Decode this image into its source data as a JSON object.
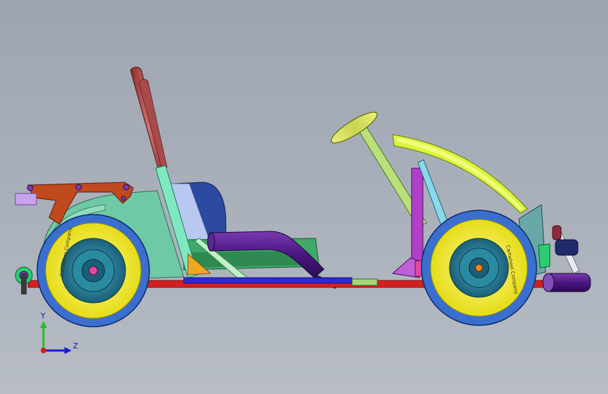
{
  "viewport": {
    "background_top": "#9ea5b1",
    "background_bottom": "#b8bdc5"
  },
  "triad": {
    "y_label": "Y",
    "z_label": "Z",
    "y_color": "#22c022",
    "z_color": "#1a1ad0",
    "x_color": "#d02020"
  },
  "tire_text": {
    "rear": "Cartwheel Company",
    "front": "Cartwheel Company"
  },
  "colors": {
    "tire": "#3a6fd0",
    "rim": "#f3ee2a",
    "hub": "#1e6f8a",
    "seat_back": "#2c4aa0",
    "fender": "#6fc9a6",
    "rear_bracket": "#c0491e",
    "exhaust": "#5a1f8a",
    "frame_red": "#d62020",
    "frame_blue": "#2a2ad6",
    "steering": "#b9e07a",
    "nose": "#d8f53a",
    "upright": "#b040c8",
    "bumper": "#5a1f8a"
  }
}
